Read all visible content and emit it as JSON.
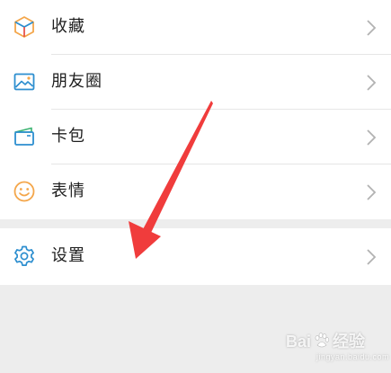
{
  "menu": {
    "items": [
      {
        "label": "收藏",
        "icon": "favorites-cube-icon"
      },
      {
        "label": "朋友圈",
        "icon": "moments-picture-icon"
      },
      {
        "label": "卡包",
        "icon": "card-wallet-icon"
      },
      {
        "label": "表情",
        "icon": "sticker-smiley-icon"
      }
    ],
    "settings": {
      "label": "设置",
      "icon": "gear-icon"
    }
  },
  "annotation": {
    "arrow_color": "#f03c3c"
  },
  "watermark": {
    "brand": "Bai",
    "brand_suffix": "经验",
    "subtitle": "jingyan.baidu.com"
  },
  "colors": {
    "background": "#ededed",
    "panel": "#ffffff",
    "text": "#1f1f1f",
    "chevron": "#b2b2b2",
    "icon_blue": "#2c8ecf",
    "icon_orange": "#f4a64a"
  }
}
